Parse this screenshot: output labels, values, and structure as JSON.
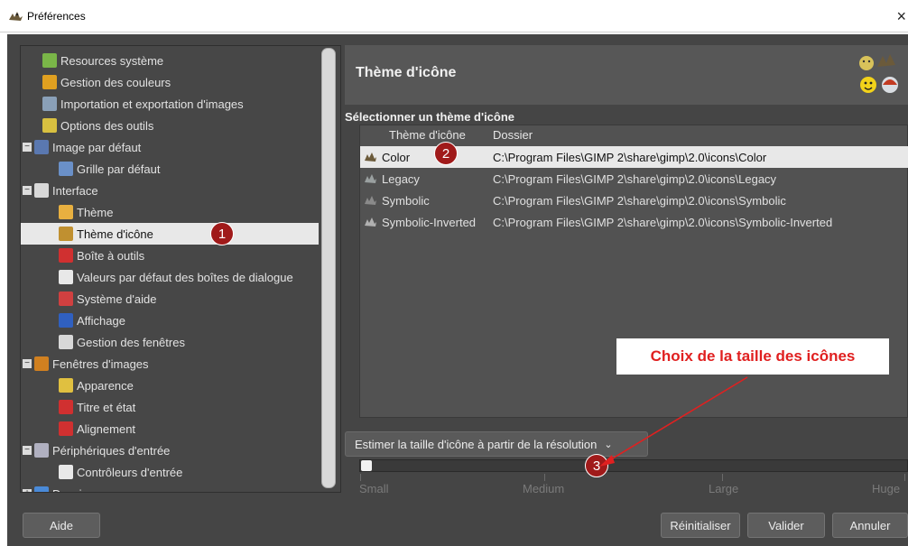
{
  "window": {
    "title": "Préférences",
    "close_glyph": "×"
  },
  "tree": {
    "items": [
      {
        "label": "Resources système",
        "icon": "system-resources-icon",
        "indent": 1
      },
      {
        "label": "Gestion des couleurs",
        "icon": "color-management-icon",
        "indent": 1
      },
      {
        "label": "Importation et exportation d'images",
        "icon": "import-export-icon",
        "indent": 1
      },
      {
        "label": "Options des outils",
        "icon": "tool-options-icon",
        "indent": 1
      },
      {
        "label": "Image par défaut",
        "icon": "default-image-icon",
        "indent": 0,
        "expander": "−"
      },
      {
        "label": "Grille par défaut",
        "icon": "grid-icon",
        "indent": 2
      },
      {
        "label": "Interface",
        "icon": "interface-icon",
        "indent": 0,
        "expander": "−"
      },
      {
        "label": "Thème",
        "icon": "theme-icon",
        "indent": 2
      },
      {
        "label": "Thème d'icône",
        "icon": "icon-theme-icon",
        "indent": 2,
        "selected": true
      },
      {
        "label": "Boîte à outils",
        "icon": "toolbox-icon",
        "indent": 2
      },
      {
        "label": "Valeurs par défaut des boîtes de dialogue",
        "icon": "dialog-defaults-icon",
        "indent": 2
      },
      {
        "label": "Système d'aide",
        "icon": "help-system-icon",
        "indent": 2
      },
      {
        "label": "Affichage",
        "icon": "display-icon",
        "indent": 2
      },
      {
        "label": "Gestion des fenêtres",
        "icon": "window-management-icon",
        "indent": 2
      },
      {
        "label": "Fenêtres d'images",
        "icon": "image-windows-icon",
        "indent": 0,
        "expander": "−"
      },
      {
        "label": "Apparence",
        "icon": "appearance-icon",
        "indent": 2
      },
      {
        "label": "Titre et état",
        "icon": "title-status-icon",
        "indent": 2
      },
      {
        "label": "Alignement",
        "icon": "snapping-icon",
        "indent": 2
      },
      {
        "label": "Périphériques d'entrée",
        "icon": "input-devices-icon",
        "indent": 0,
        "expander": "−"
      },
      {
        "label": "Contrôleurs d'entrée",
        "icon": "input-controllers-icon",
        "indent": 2
      },
      {
        "label": "Dossiers",
        "icon": "folders-icon",
        "indent": 0,
        "expander": "+"
      }
    ]
  },
  "page": {
    "title": "Thème d'icône",
    "section_title": "Sélectionner un thème d'icône"
  },
  "theme_table": {
    "columns": [
      "Thème d'icône",
      "Dossier"
    ],
    "rows": [
      {
        "name": "Color",
        "path": "C:\\Program Files\\GIMP 2\\share\\gimp\\2.0\\icons\\Color",
        "selected": true
      },
      {
        "name": "Legacy",
        "path": "C:\\Program Files\\GIMP 2\\share\\gimp\\2.0\\icons\\Legacy"
      },
      {
        "name": "Symbolic",
        "path": "C:\\Program Files\\GIMP 2\\share\\gimp\\2.0\\icons\\Symbolic"
      },
      {
        "name": "Symbolic-Inverted",
        "path": "C:\\Program Files\\GIMP 2\\share\\gimp\\2.0\\icons\\Symbolic-Inverted"
      }
    ]
  },
  "icon_size": {
    "estimate_label": "Estimer la taille d'icône à partir de la résolution",
    "labels": [
      "Small",
      "Medium",
      "Large",
      "Huge"
    ],
    "value_fraction": 0
  },
  "buttons": {
    "help": "Aide",
    "reset": "Réinitialiser",
    "ok": "Valider",
    "cancel": "Annuler"
  },
  "annotations": {
    "badge1": "1",
    "badge2": "2",
    "badge3": "3",
    "callout": "Choix de la taille des icônes",
    "color": "#e02020"
  }
}
